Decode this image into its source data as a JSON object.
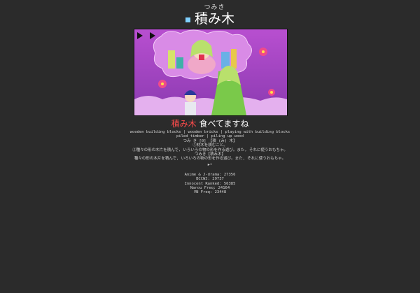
{
  "card": {
    "reading": "つみき",
    "word": "積み木",
    "icon": "square-bullet-icon",
    "accent": "#ff4b4b"
  },
  "sentence": {
    "highlight": "積み木",
    "rest": " 食べてますね"
  },
  "definitions": [
    "wooden building blocks | wooden bricks | playing with building blocks",
    "piled timber | piling up wood",
    "つみ き [0] 【積 (み) 木】",
    "①材木を積むこと。",
    "②種々の形の木片を積んで, いろいろの物の形を作る遊び。また, それに使うおもちゃ。",
    "つみき【積み木】",
    "種々の形の木片を積んで, いろいろの物の形を作る遊び。また, それに使うおもちゃ。"
  ],
  "audio": {
    "icon": "speaker-icon",
    "label": "•"
  },
  "frequencies": [
    "Anime & J-drama: 27356",
    "BCCWJ: 29737",
    "Innocent Ranked: 56385",
    "Narou Freq: 24164",
    "VN Freq: 23448"
  ]
}
